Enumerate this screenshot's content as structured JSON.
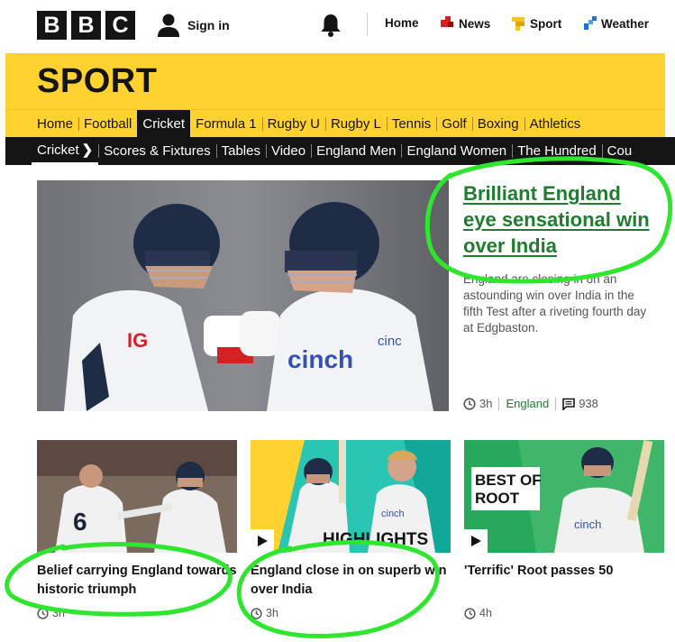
{
  "masthead": {
    "logo_letters": [
      "B",
      "B",
      "C"
    ],
    "signin_label": "Sign in",
    "icons": {
      "user": "user-icon",
      "notifications": "bell-icon"
    },
    "nav": [
      {
        "label": "Home",
        "icon": ""
      },
      {
        "label": "News",
        "icon": "news-icon",
        "color": "#e01b1b"
      },
      {
        "label": "Sport",
        "icon": "sport-icon",
        "color": "#f5c518"
      },
      {
        "label": "Weather",
        "icon": "weather-icon",
        "color": "#1b73d6"
      }
    ]
  },
  "sport": {
    "title": "SPORT",
    "primary_nav": [
      "Home",
      "Football",
      "Cricket",
      "Formula 1",
      "Rugby U",
      "Rugby L",
      "Tennis",
      "Golf",
      "Boxing",
      "Athletics"
    ],
    "primary_active": "Cricket",
    "secondary_nav": [
      "Cricket",
      "Scores & Fixtures",
      "Tables",
      "Video",
      "England Men",
      "England Women",
      "The Hundred",
      "Cou"
    ]
  },
  "hero": {
    "headline": "Brilliant England eye sensational win over India",
    "summary": "England are closing in on an astounding win over India in the fifth Test after a riveting fourth day at Edgbaston.",
    "time": "3h",
    "tag": "England",
    "comments": "938"
  },
  "cards": [
    {
      "headline": "Belief carrying England towards historic triumph",
      "time": "3h",
      "has_play": false
    },
    {
      "headline": "England close in on superb win over India",
      "time": "3h",
      "has_play": true,
      "overlay_text": "HIGHLIGHTS"
    },
    {
      "headline": "'Terrific' Root passes 50",
      "time": "4h",
      "has_play": true,
      "overlay_text": "BEST OF ROOT"
    }
  ],
  "colors": {
    "brand_yellow": "#ffd230",
    "link_green": "#1e7d2f",
    "annotation_green": "#2ee62e"
  }
}
